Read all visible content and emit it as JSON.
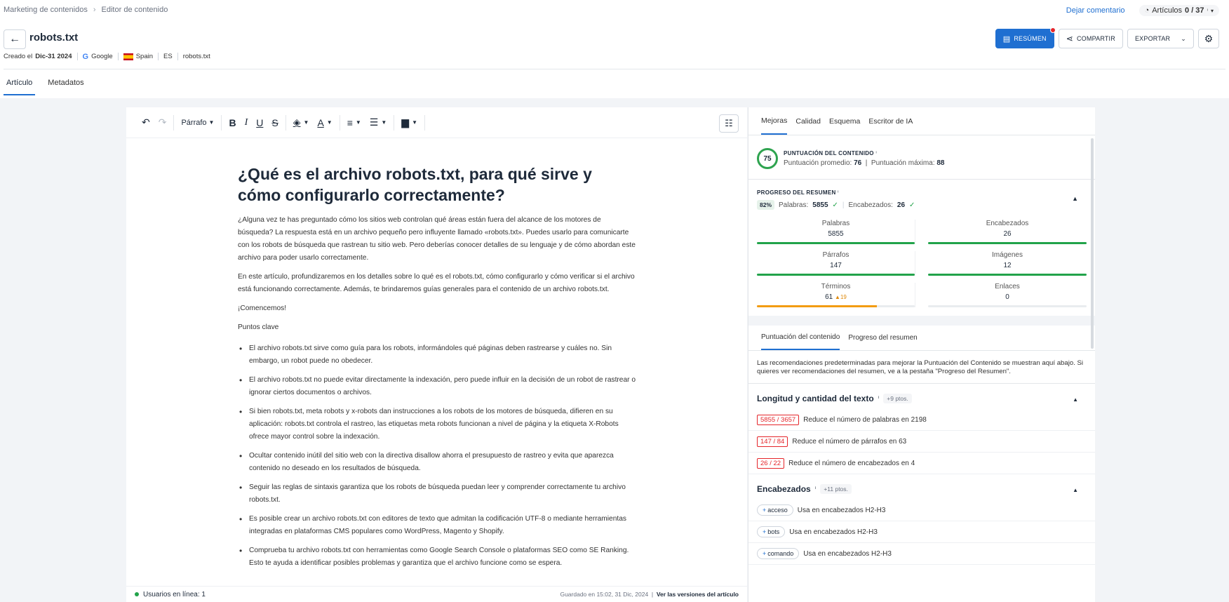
{
  "breadcrumb": {
    "parent": "Marketing de contenidos",
    "current": "Editor de contenido"
  },
  "top": {
    "comment_link": "Dejar comentario",
    "quota_label": "Artículos",
    "quota_value": "0 / 37"
  },
  "doc": {
    "title": "robots.txt",
    "created_label": "Creado el",
    "created_date": "Dic-31 2024",
    "engine": "Google",
    "country": "Spain",
    "lang": "ES",
    "keyword": "robots.txt"
  },
  "actions": {
    "summary": "RESÚMEN",
    "share": "COMPARTIR",
    "export": "EXPORTAR"
  },
  "tabs": [
    "Artículo",
    "Metadatos"
  ],
  "toolbar": {
    "paragraph": "Párrafo"
  },
  "article": {
    "h1": "¿Qué es el archivo robots.txt, para qué sirve y cómo configurarlo correctamente?",
    "p1": "¿Alguna vez te has preguntado cómo los sitios web controlan qué áreas están fuera del alcance de los motores de búsqueda? La respuesta está en un archivo pequeño pero influyente llamado «robots.txt». Puedes usarlo para comunicarte con los robots de búsqueda que rastrean tu sitio web. Pero deberías conocer detalles de su lenguaje y de cómo abordan este archivo para poder usarlo correctamente.",
    "p2": "En este artículo, profundizaremos en los detalles sobre lo qué es el robots.txt, cómo configurarlo y cómo verificar si el archivo está funcionando correctamente. Además, te brindaremos guías generales para el contenido de un archivo robots.txt.",
    "p3": "¡Comencemos!",
    "p4": "Puntos clave",
    "bullets": [
      "El archivo robots.txt sirve como guía para los robots, informándoles qué páginas deben rastrearse y cuáles no. Sin embargo, un robot puede no obedecer.",
      "El archivo robots.txt no puede evitar directamente la indexación, pero puede influir en la decisión de un robot de rastrear o ignorar ciertos documentos o archivos.",
      "Si bien robots.txt, meta robots y x-robots dan instrucciones a los robots de los motores de búsqueda, difieren en su aplicación: robots.txt controla el rastreo, las etiquetas meta robots funcionan a nivel de página y la etiqueta X-Robots ofrece mayor control sobre la indexación.",
      "Ocultar contenido inútil del sitio web con la directiva disallow ahorra el presupuesto de rastreo y evita que aparezca contenido no deseado en los resultados de búsqueda.",
      "Seguir las reglas de sintaxis garantiza que los robots de búsqueda puedan leer y comprender correctamente tu archivo robots.txt.",
      "Es posible crear un archivo robots.txt con editores de texto que admitan la codificación UTF-8 o mediante herramientas integradas en plataformas CMS populares como WordPress, Magento y Shopify.",
      "Comprueba tu archivo robots.txt con herramientas como Google Search Console o plataformas SEO como SE Ranking. Esto te ayuda a identificar posibles problemas y garantiza que el archivo funcione como se espera."
    ]
  },
  "footer": {
    "online": "Usuarios en línea: 1",
    "saved": "Guardado en 15:02, 31 Dic, 2024",
    "versions": "Ver las versiones del artículo"
  },
  "panel": {
    "tabs": [
      "Mejoras",
      "Calidad",
      "Esquema",
      "Escritor de IA"
    ],
    "score": {
      "value": "75",
      "title": "PUNTUACIÓN DEL CONTENIDO",
      "avg_label": "Puntuación promedio:",
      "avg": "76",
      "max_label": "Puntuación máxima:",
      "max": "88"
    },
    "progress": {
      "title": "PROGRESO DEL RESUMEN",
      "pct": "82%",
      "words_label": "Palabras:",
      "words": "5855",
      "headings_label": "Encabezados:",
      "headings": "26"
    },
    "metrics": [
      {
        "label": "Palabras",
        "value": "5855",
        "fill": 1.0,
        "color": "green",
        "extra": ""
      },
      {
        "label": "Encabezados",
        "value": "26",
        "fill": 1.0,
        "color": "green",
        "extra": ""
      },
      {
        "label": "Párrafos",
        "value": "147",
        "fill": 1.0,
        "color": "green",
        "extra": ""
      },
      {
        "label": "Imágenes",
        "value": "12",
        "fill": 1.0,
        "color": "green",
        "extra": ""
      },
      {
        "label": "Términos",
        "value": "61",
        "fill": 0.76,
        "color": "orange",
        "extra": "▲19"
      },
      {
        "label": "Enlaces",
        "value": "0",
        "fill": 0,
        "color": "green",
        "extra": ""
      }
    ],
    "subtabs": [
      "Puntuación del contenido",
      "Progreso del resumen"
    ],
    "note": "Las recomendaciones predeterminadas para mejorar la Puntuación del Contenido se muestran aquí abajo. Si quieres ver recomendaciones del resumen, ve a la pestaña \"Progreso del Resumen\".",
    "length_section": {
      "title": "Longitud y cantidad del texto",
      "pts": "+9 ptos."
    },
    "length_recs": [
      {
        "badge": "5855 / 3657",
        "text": "Reduce el número de palabras en 2198"
      },
      {
        "badge": "147 / 84",
        "text": "Reduce el número de párrafos en 63"
      },
      {
        "badge": "26 / 22",
        "text": "Reduce el número de encabezados en 4"
      }
    ],
    "headings_section": {
      "title": "Encabezados",
      "pts": "+11 ptos."
    },
    "heading_recs": [
      {
        "chip": "acceso",
        "text": "Usa en encabezados H2-H3"
      },
      {
        "chip": "bots",
        "text": "Usa en encabezados H2-H3"
      },
      {
        "chip": "comando",
        "text": "Usa en encabezados H2-H3"
      }
    ]
  }
}
